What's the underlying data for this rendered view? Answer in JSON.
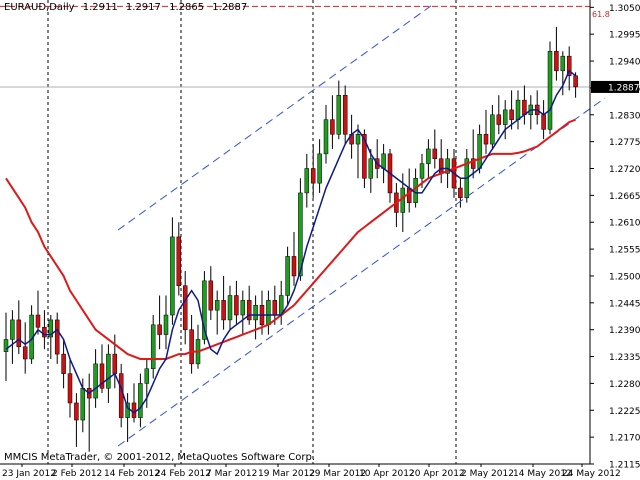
{
  "header": {
    "symbol": "EURAUD,Daily",
    "open": "1.2911",
    "high": "1.2917",
    "low": "1.2865",
    "close": "1.2887"
  },
  "footer_text": "MMCIS MetaTrader, © 2001-2012, MetaQuotes Software Corp.",
  "fibo_label": "61.8",
  "colors": {
    "grid": "#000000",
    "axis": "#000000",
    "bull_candle": "#1e9e1e",
    "bear_candle": "#d01010",
    "ma_fast": "#0c1a8c",
    "ma_slow": "#e01818",
    "channel": "#3050e0",
    "fibo_line": "#e02020",
    "bid_line": "#b0b0b0"
  },
  "chart_data": {
    "type": "candlestick",
    "symbol": "EURAUD",
    "timeframe": "Daily",
    "ylim": [
      2.162,
      1.3065
    ],
    "y_ticks": [
      "1.3050",
      "1.2995",
      "1.2940",
      "1.2885",
      "1.2830",
      "1.2775",
      "1.2720",
      "1.2665",
      "1.2610",
      "1.2555",
      "1.2500",
      "1.2445",
      "1.2390",
      "1.2335",
      "1.2280",
      "1.2225",
      "1.2170",
      "1.2115"
    ],
    "current_price_label": "1.2887",
    "x_labels": [
      "23 Jan 2012",
      "2 Feb 2012",
      "14 Feb 2012",
      "24 Feb 2012",
      "7 Mar 2012",
      "19 Mar 2012",
      "29 Mar 2012",
      "10 Apr 2012",
      "20 Apr 2012",
      "2 May 2012",
      "14 May 2012",
      "24 May 2012"
    ],
    "fibo_level": {
      "label": "61.8",
      "price": 1.3052
    },
    "candles": [
      {
        "o": 1.2345,
        "h": 1.2425,
        "l": 1.2285,
        "c": 1.237
      },
      {
        "o": 1.237,
        "h": 1.243,
        "l": 1.232,
        "c": 1.241
      },
      {
        "o": 1.241,
        "h": 1.245,
        "l": 1.234,
        "c": 1.2355
      },
      {
        "o": 1.2355,
        "h": 1.2405,
        "l": 1.23,
        "c": 1.233
      },
      {
        "o": 1.233,
        "h": 1.244,
        "l": 1.232,
        "c": 1.242
      },
      {
        "o": 1.242,
        "h": 1.247,
        "l": 1.238,
        "c": 1.2395
      },
      {
        "o": 1.2395,
        "h": 1.243,
        "l": 1.235,
        "c": 1.2375
      },
      {
        "o": 1.2375,
        "h": 1.242,
        "l": 1.233,
        "c": 1.241
      },
      {
        "o": 1.241,
        "h": 1.2425,
        "l": 1.232,
        "c": 1.234
      },
      {
        "o": 1.234,
        "h": 1.237,
        "l": 1.227,
        "c": 1.23
      },
      {
        "o": 1.23,
        "h": 1.233,
        "l": 1.221,
        "c": 1.224
      },
      {
        "o": 1.224,
        "h": 1.226,
        "l": 1.215,
        "c": 1.2205
      },
      {
        "o": 1.2205,
        "h": 1.229,
        "l": 1.218,
        "c": 1.227
      },
      {
        "o": 1.227,
        "h": 1.23,
        "l": 1.214,
        "c": 1.225
      },
      {
        "o": 1.225,
        "h": 1.235,
        "l": 1.223,
        "c": 1.232
      },
      {
        "o": 1.232,
        "h": 1.236,
        "l": 1.226,
        "c": 1.227
      },
      {
        "o": 1.227,
        "h": 1.236,
        "l": 1.224,
        "c": 1.234
      },
      {
        "o": 1.234,
        "h": 1.238,
        "l": 1.227,
        "c": 1.23
      },
      {
        "o": 1.23,
        "h": 1.232,
        "l": 1.219,
        "c": 1.221
      },
      {
        "o": 1.221,
        "h": 1.226,
        "l": 1.216,
        "c": 1.224
      },
      {
        "o": 1.224,
        "h": 1.228,
        "l": 1.22,
        "c": 1.221
      },
      {
        "o": 1.221,
        "h": 1.23,
        "l": 1.219,
        "c": 1.228
      },
      {
        "o": 1.228,
        "h": 1.233,
        "l": 1.223,
        "c": 1.231
      },
      {
        "o": 1.231,
        "h": 1.242,
        "l": 1.229,
        "c": 1.24
      },
      {
        "o": 1.24,
        "h": 1.246,
        "l": 1.235,
        "c": 1.238
      },
      {
        "o": 1.238,
        "h": 1.246,
        "l": 1.235,
        "c": 1.242
      },
      {
        "o": 1.242,
        "h": 1.262,
        "l": 1.24,
        "c": 1.258
      },
      {
        "o": 1.258,
        "h": 1.261,
        "l": 1.246,
        "c": 1.248
      },
      {
        "o": 1.248,
        "h": 1.251,
        "l": 1.236,
        "c": 1.239
      },
      {
        "o": 1.239,
        "h": 1.242,
        "l": 1.23,
        "c": 1.232
      },
      {
        "o": 1.232,
        "h": 1.24,
        "l": 1.231,
        "c": 1.237
      },
      {
        "o": 1.237,
        "h": 1.251,
        "l": 1.236,
        "c": 1.249
      },
      {
        "o": 1.249,
        "h": 1.252,
        "l": 1.241,
        "c": 1.243
      },
      {
        "o": 1.243,
        "h": 1.247,
        "l": 1.238,
        "c": 1.245
      },
      {
        "o": 1.245,
        "h": 1.25,
        "l": 1.239,
        "c": 1.241
      },
      {
        "o": 1.241,
        "h": 1.248,
        "l": 1.239,
        "c": 1.246
      },
      {
        "o": 1.246,
        "h": 1.249,
        "l": 1.24,
        "c": 1.242
      },
      {
        "o": 1.242,
        "h": 1.247,
        "l": 1.238,
        "c": 1.245
      },
      {
        "o": 1.245,
        "h": 1.248,
        "l": 1.24,
        "c": 1.241
      },
      {
        "o": 1.241,
        "h": 1.246,
        "l": 1.237,
        "c": 1.244
      },
      {
        "o": 1.244,
        "h": 1.247,
        "l": 1.238,
        "c": 1.24
      },
      {
        "o": 1.24,
        "h": 1.247,
        "l": 1.238,
        "c": 1.245
      },
      {
        "o": 1.245,
        "h": 1.248,
        "l": 1.24,
        "c": 1.242
      },
      {
        "o": 1.242,
        "h": 1.249,
        "l": 1.24,
        "c": 1.246
      },
      {
        "o": 1.246,
        "h": 1.256,
        "l": 1.244,
        "c": 1.254
      },
      {
        "o": 1.254,
        "h": 1.259,
        "l": 1.248,
        "c": 1.25
      },
      {
        "o": 1.25,
        "h": 1.27,
        "l": 1.249,
        "c": 1.267
      },
      {
        "o": 1.267,
        "h": 1.275,
        "l": 1.264,
        "c": 1.272
      },
      {
        "o": 1.272,
        "h": 1.277,
        "l": 1.266,
        "c": 1.269
      },
      {
        "o": 1.269,
        "h": 1.278,
        "l": 1.267,
        "c": 1.275
      },
      {
        "o": 1.275,
        "h": 1.285,
        "l": 1.273,
        "c": 1.282
      },
      {
        "o": 1.282,
        "h": 1.287,
        "l": 1.276,
        "c": 1.279
      },
      {
        "o": 1.279,
        "h": 1.29,
        "l": 1.278,
        "c": 1.287
      },
      {
        "o": 1.287,
        "h": 1.289,
        "l": 1.277,
        "c": 1.279
      },
      {
        "o": 1.279,
        "h": 1.283,
        "l": 1.274,
        "c": 1.277
      },
      {
        "o": 1.277,
        "h": 1.281,
        "l": 1.27,
        "c": 1.279
      },
      {
        "o": 1.279,
        "h": 1.28,
        "l": 1.268,
        "c": 1.27
      },
      {
        "o": 1.27,
        "h": 1.276,
        "l": 1.267,
        "c": 1.274
      },
      {
        "o": 1.274,
        "h": 1.278,
        "l": 1.27,
        "c": 1.272
      },
      {
        "o": 1.272,
        "h": 1.277,
        "l": 1.269,
        "c": 1.275
      },
      {
        "o": 1.275,
        "h": 1.276,
        "l": 1.265,
        "c": 1.267
      },
      {
        "o": 1.267,
        "h": 1.269,
        "l": 1.26,
        "c": 1.263
      },
      {
        "o": 1.263,
        "h": 1.271,
        "l": 1.259,
        "c": 1.268
      },
      {
        "o": 1.268,
        "h": 1.272,
        "l": 1.263,
        "c": 1.265
      },
      {
        "o": 1.265,
        "h": 1.272,
        "l": 1.264,
        "c": 1.27
      },
      {
        "o": 1.27,
        "h": 1.275,
        "l": 1.268,
        "c": 1.273
      },
      {
        "o": 1.273,
        "h": 1.278,
        "l": 1.27,
        "c": 1.276
      },
      {
        "o": 1.276,
        "h": 1.28,
        "l": 1.272,
        "c": 1.274
      },
      {
        "o": 1.274,
        "h": 1.278,
        "l": 1.269,
        "c": 1.271
      },
      {
        "o": 1.271,
        "h": 1.276,
        "l": 1.268,
        "c": 1.274
      },
      {
        "o": 1.274,
        "h": 1.276,
        "l": 1.266,
        "c": 1.268
      },
      {
        "o": 1.268,
        "h": 1.27,
        "l": 1.264,
        "c": 1.266
      },
      {
        "o": 1.266,
        "h": 1.276,
        "l": 1.265,
        "c": 1.274
      },
      {
        "o": 1.274,
        "h": 1.28,
        "l": 1.27,
        "c": 1.272
      },
      {
        "o": 1.272,
        "h": 1.281,
        "l": 1.271,
        "c": 1.279
      },
      {
        "o": 1.279,
        "h": 1.284,
        "l": 1.275,
        "c": 1.277
      },
      {
        "o": 1.277,
        "h": 1.285,
        "l": 1.276,
        "c": 1.283
      },
      {
        "o": 1.283,
        "h": 1.287,
        "l": 1.279,
        "c": 1.281
      },
      {
        "o": 1.281,
        "h": 1.286,
        "l": 1.278,
        "c": 1.284
      },
      {
        "o": 1.284,
        "h": 1.288,
        "l": 1.28,
        "c": 1.282
      },
      {
        "o": 1.282,
        "h": 1.288,
        "l": 1.28,
        "c": 1.286
      },
      {
        "o": 1.286,
        "h": 1.289,
        "l": 1.281,
        "c": 1.283
      },
      {
        "o": 1.283,
        "h": 1.287,
        "l": 1.28,
        "c": 1.285
      },
      {
        "o": 1.285,
        "h": 1.288,
        "l": 1.281,
        "c": 1.283
      },
      {
        "o": 1.283,
        "h": 1.286,
        "l": 1.278,
        "c": 1.28
      },
      {
        "o": 1.28,
        "h": 1.298,
        "l": 1.279,
        "c": 1.296
      },
      {
        "o": 1.296,
        "h": 1.301,
        "l": 1.29,
        "c": 1.292
      },
      {
        "o": 1.292,
        "h": 1.296,
        "l": 1.287,
        "c": 1.295
      },
      {
        "o": 1.295,
        "h": 1.297,
        "l": 1.288,
        "c": 1.291
      },
      {
        "o": 1.291,
        "h": 1.2917,
        "l": 1.2865,
        "c": 1.2887
      }
    ],
    "ma_fast": [
      1.235,
      1.236,
      1.237,
      1.236,
      1.237,
      1.239,
      1.238,
      1.238,
      1.239,
      1.237,
      1.233,
      1.23,
      1.227,
      1.226,
      1.227,
      1.228,
      1.229,
      1.23,
      1.227,
      1.223,
      1.222,
      1.223,
      1.225,
      1.228,
      1.231,
      1.233,
      1.239,
      1.243,
      1.245,
      1.247,
      1.245,
      1.239,
      1.235,
      1.234,
      1.237,
      1.239,
      1.24,
      1.241,
      1.242,
      1.242,
      1.242,
      1.242,
      1.242,
      1.242,
      1.244,
      1.247,
      1.251,
      1.256,
      1.26,
      1.264,
      1.268,
      1.271,
      1.274,
      1.277,
      1.279,
      1.28,
      1.278,
      1.275,
      1.273,
      1.272,
      1.271,
      1.27,
      1.269,
      1.268,
      1.267,
      1.267,
      1.269,
      1.271,
      1.272,
      1.272,
      1.271,
      1.27,
      1.27,
      1.271,
      1.272,
      1.274,
      1.276,
      1.278,
      1.28,
      1.281,
      1.282,
      1.283,
      1.284,
      1.284,
      1.283,
      1.284,
      1.287,
      1.289,
      1.292,
      1.291
    ],
    "ma_slow": [
      1.27,
      1.268,
      1.266,
      1.264,
      1.261,
      1.259,
      1.256,
      1.254,
      1.252,
      1.25,
      1.247,
      1.245,
      1.243,
      1.241,
      1.239,
      1.238,
      1.237,
      1.236,
      1.235,
      1.234,
      1.2335,
      1.233,
      1.233,
      1.233,
      1.233,
      1.233,
      1.2335,
      1.234,
      1.234,
      1.2345,
      1.2345,
      1.235,
      1.2355,
      1.236,
      1.2365,
      1.237,
      1.2375,
      1.238,
      1.2385,
      1.239,
      1.2395,
      1.24,
      1.241,
      1.242,
      1.243,
      1.244,
      1.2455,
      1.247,
      1.2485,
      1.25,
      1.2515,
      1.253,
      1.2545,
      1.256,
      1.2575,
      1.259,
      1.26,
      1.261,
      1.262,
      1.263,
      1.264,
      1.265,
      1.266,
      1.267,
      1.268,
      1.269,
      1.27,
      1.2705,
      1.271,
      1.2715,
      1.272,
      1.2725,
      1.273,
      1.2735,
      1.274,
      1.2745,
      1.275,
      1.275,
      1.275,
      1.275,
      1.2752,
      1.2755,
      1.276,
      1.2765,
      1.2775,
      1.2785,
      1.2795,
      1.2805,
      1.2815,
      1.282
    ]
  }
}
